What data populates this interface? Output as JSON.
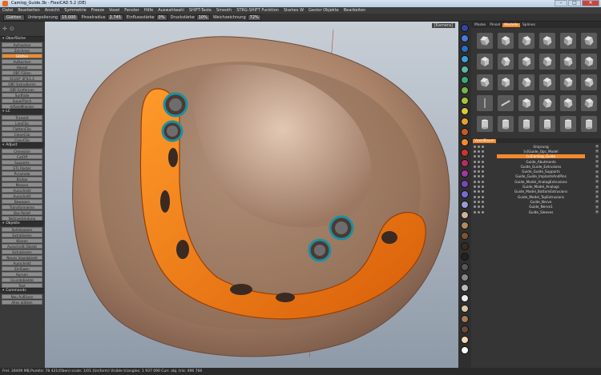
{
  "window": {
    "title": "Camlog_Guide.3b - FlexiCAD 5.2 (DE)",
    "min": "–",
    "max": "□",
    "close": "✕"
  },
  "menu": [
    "Datei",
    "Bearbeiten",
    "Ansicht",
    "Symmetrie",
    "Freeze",
    "Voxel",
    "Fenster",
    "Hilfe",
    "Auswahlwahl",
    "SHIFT-Taste",
    "Smooth",
    "STRG-SHIFT Funktion",
    "Starkes W",
    "Gestor Objekte",
    "Bearbeiten"
  ],
  "toolbar": {
    "mode": "Glätten",
    "p1_label": "Unterpolierung",
    "p1_value": "15.000",
    "p2_label": "Pinselradius",
    "p2_value": "2.745",
    "p3_label": "Einflussstärke",
    "p3_value": "0%",
    "p4_label": "Druckstärke",
    "p4_value": "10%",
    "p5_label": "Weichzeichnung",
    "p5_value": "72%"
  },
  "left_panel": {
    "sections": [
      {
        "title": "Oberfläche",
        "buttons": [
          "Aufrauhen",
          "Zeichnen",
          "Glätten",
          "Aufkochen",
          "Hessel",
          "OBF-Füllen",
          "SCULP_SFIL1.2",
          "OBF-Extrudieren",
          "OBF-Entfernen",
          "Surfhide",
          "SuperPinch",
          "InflateMinister"
        ]
      },
      {
        "title": "LC",
        "buttons": [
          "Transkit",
          "LineClip",
          "FlattenClip",
          "CleanClip",
          "CopyClip"
        ]
      },
      {
        "title": "Adjust",
        "buttons": [
          "Clenesion",
          "CutOff",
          "Supports",
          "STL Raster",
          "Pyramide",
          "Bridge",
          "Messen",
          "Ausschnitt",
          "Ausschnitt",
          "Bewegen",
          "Transformieren",
          "Box Relief",
          "Netzverbindung"
        ]
      },
      {
        "title": "Objekte",
        "buttons": [
          "Spitzkappen",
          "Extrahieren",
          "Klonen",
          "Ausschnitt Objekt",
          "Extrahieren",
          "Neues Voxelobjekt",
          "Ausschnitt",
          "Einfügen",
          "Kurven",
          "Grundobjekte",
          "Text"
        ]
      },
      {
        "title": "Commands",
        "buttons": [
          "Neu Auflösen",
          "Alles glätten"
        ]
      }
    ],
    "active_button": "Glätten"
  },
  "right_panel": {
    "tabs": [
      "Maske",
      "Pinsel",
      "Modelle",
      "Splines"
    ],
    "active_tab": "Modelle",
    "brush_count": 30,
    "scene_title": "VoxelBaum",
    "scene_items": [
      "Ursprung",
      "[v]Guide_Opc_Model",
      "[v]Camlog_Guide",
      "Guide_Abutments",
      "Guide_Guide_Extrusions",
      "Guide_Guide_Supports",
      "Guide_Guide_ImplantsAndPins",
      "Guide_Model_AnalogExtrusions",
      "Guide_Model_Analogs",
      "Guide_Model_BottomExtrusions",
      "Guide_Model_TopExtrusions",
      "Guide_Nerve",
      "Guide_Nerve1",
      "Guide_Sleeves"
    ],
    "active_scene_item": "[v]Camlog_Guide"
  },
  "colors": {
    "accent": "#f28a2e",
    "swatches": [
      "#3344aa",
      "#4a7ad8",
      "#2a6fbf",
      "#3fa0d6",
      "#5fb5a5",
      "#3aa87a",
      "#76b34a",
      "#a8c43d",
      "#d9c93b",
      "#e3a12f",
      "#c45a28",
      "#f28a2e",
      "#c43a2a",
      "#b22f5e",
      "#9e3aa0",
      "#7a47b6",
      "#7a6bd1",
      "#9a9ad8",
      "#c9b39a",
      "#b08b5e",
      "#7a5436",
      "#3b2a1e",
      "#222222",
      "#555555",
      "#888888",
      "#bbbbbb",
      "#eeeeee",
      "#d8c8a8",
      "#a87a5a",
      "#6b4a3a",
      "#f4d7b0",
      "#ffffff"
    ]
  },
  "viewport": {
    "camera_button": "[Kamera]"
  },
  "status": "Frei: 28409 MB,Punkte: 78 421(Oben) scale: 1/01 (Uniform) Visible triangles: 1 937 090 Curr. obj. tria: 496 766"
}
